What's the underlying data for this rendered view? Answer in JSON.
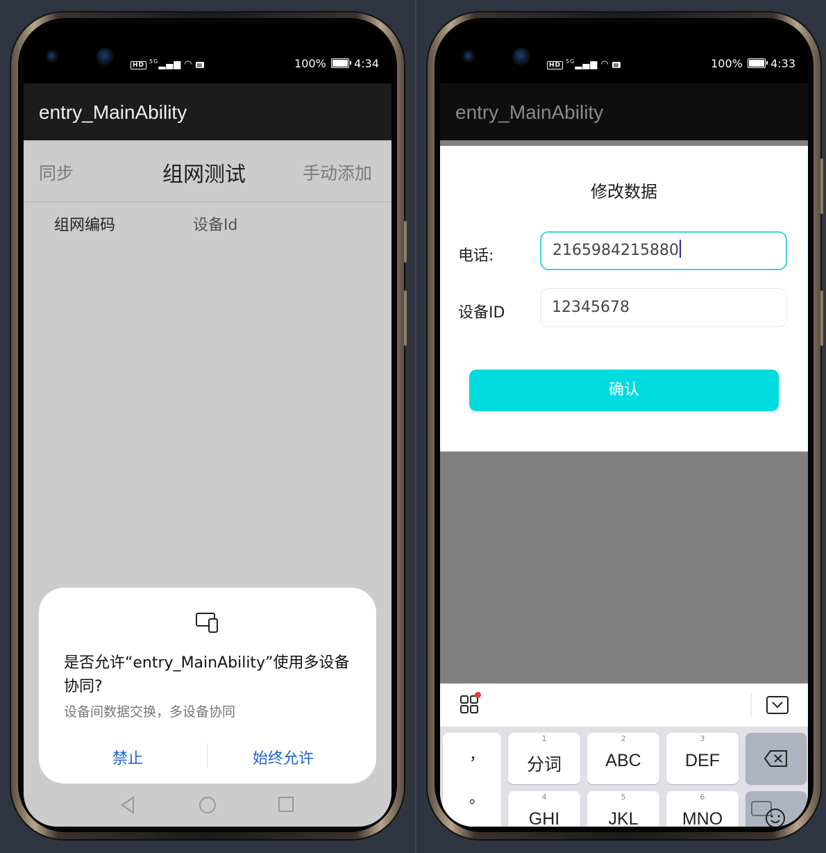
{
  "left_phone": {
    "status": {
      "battery": "100%",
      "time": "4:34",
      "hd": "HD",
      "signal": "5G"
    },
    "app_title": "entry_MainAbility",
    "tabs": {
      "sync": "同步",
      "title": "组网测试",
      "manual_add": "手动添加"
    },
    "columns": {
      "network_code": "组网编码",
      "device_id": "设备Id"
    },
    "dialog": {
      "title": "是否允许“entry_MainAbility”使用多设备协同?",
      "subtitle": "设备间数据交换，多设备协同",
      "deny": "禁止",
      "allow": "始终允许"
    }
  },
  "right_phone": {
    "status": {
      "battery": "100%",
      "time": "4:33",
      "hd": "HD",
      "signal": "5G"
    },
    "app_title": "entry_MainAbility",
    "modal": {
      "title": "修改数据",
      "phone_label": "电话:",
      "phone_value": "2165984215880",
      "device_label": "设备ID",
      "device_value": "12345678",
      "confirm": "确认"
    },
    "keyboard": {
      "punct_comma": "，",
      "punct_period": "。",
      "keys": [
        {
          "num": "1",
          "label": "分词"
        },
        {
          "num": "2",
          "label": "ABC"
        },
        {
          "num": "3",
          "label": "DEF"
        },
        {
          "num": "4",
          "label": "GHI"
        },
        {
          "num": "5",
          "label": "JKL"
        },
        {
          "num": "6",
          "label": "MNO"
        }
      ]
    }
  },
  "colors": {
    "accent": "#00dbe0",
    "focus_border": "#3bd2dc",
    "dialog_button": "#1a62d6",
    "overlay_left": "#cccccc",
    "overlay_right": "#808080"
  }
}
